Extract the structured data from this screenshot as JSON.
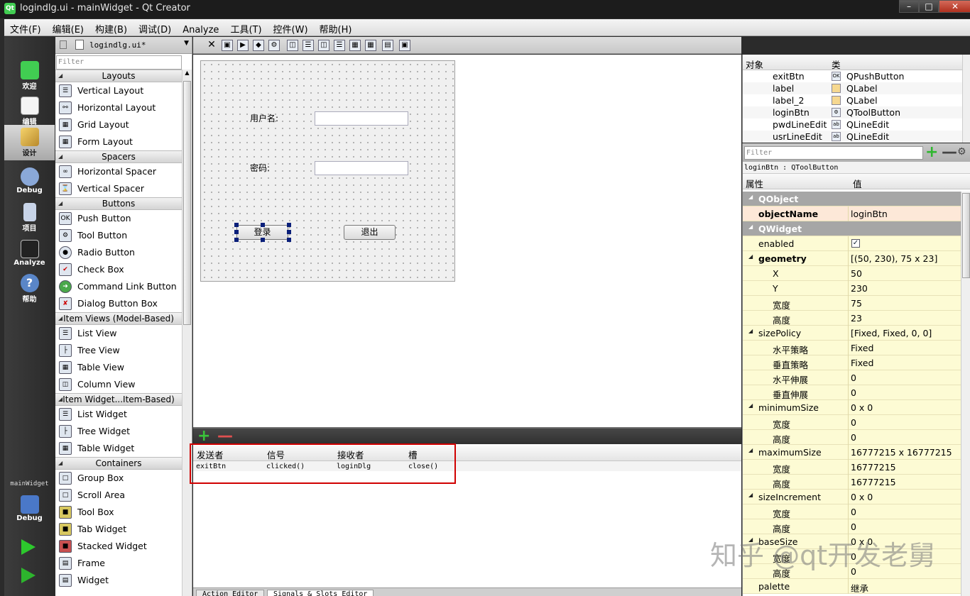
{
  "window": {
    "title": "logindlg.ui - mainWidget - Qt Creator",
    "icon_label": "Qt"
  },
  "menubar": [
    "文件(F)",
    "编辑(E)",
    "构建(B)",
    "调试(D)",
    "Analyze",
    "工具(T)",
    "控件(W)",
    "帮助(H)"
  ],
  "modes": [
    {
      "label": "欢迎",
      "icon": "qt-logo-icon"
    },
    {
      "label": "编辑",
      "icon": "edit-document-icon"
    },
    {
      "label": "设计",
      "icon": "design-pencil-icon"
    },
    {
      "label": "Debug",
      "icon": "debug-bug-icon"
    },
    {
      "label": "项目",
      "icon": "project-icon"
    },
    {
      "label": "Analyze",
      "icon": "analyze-scope-icon"
    },
    {
      "label": "帮助",
      "icon": "help-icon"
    }
  ],
  "kit": {
    "project": "mainWidget",
    "config": "Debug"
  },
  "editor_file": "logindlg.ui*",
  "widgetbox": {
    "filter_placeholder": "Filter",
    "categories": [
      {
        "name": "Layouts",
        "items": [
          "Vertical Layout",
          "Horizontal Layout",
          "Grid Layout",
          "Form Layout"
        ]
      },
      {
        "name": "Spacers",
        "items": [
          "Horizontal Spacer",
          "Vertical Spacer"
        ]
      },
      {
        "name": "Buttons",
        "items": [
          "Push Button",
          "Tool Button",
          "Radio Button",
          "Check Box",
          "Command Link Button",
          "Dialog Button Box"
        ]
      },
      {
        "name": "Item Views (Model-Based)",
        "items": [
          "List View",
          "Tree View",
          "Table View",
          "Column View"
        ]
      },
      {
        "name": "Item Widget...Item-Based)",
        "items": [
          "List Widget",
          "Tree Widget",
          "Table Widget"
        ]
      },
      {
        "name": "Containers",
        "items": [
          "Group Box",
          "Scroll Area",
          "Tool Box",
          "Tab Widget",
          "Stacked Widget",
          "Frame",
          "Widget"
        ]
      }
    ]
  },
  "form": {
    "username_label": "用户名:",
    "password_label": "密码:",
    "login_button": "登录",
    "exit_button": "退出"
  },
  "signals_slots": {
    "columns": [
      "发送者",
      "信号",
      "接收者",
      "槽"
    ],
    "rows": [
      {
        "sender": "exitBtn",
        "signal": "clicked()",
        "receiver": "loginDlg",
        "slot": "close()"
      }
    ],
    "tabs": [
      "Action Editor",
      "Signals & Slots Editor"
    ]
  },
  "object_inspector": {
    "columns": [
      "对象",
      "类"
    ],
    "rows": [
      {
        "object": "exitBtn",
        "class": "QPushButton"
      },
      {
        "object": "label",
        "class": "QLabel"
      },
      {
        "object": "label_2",
        "class": "QLabel"
      },
      {
        "object": "loginBtn",
        "class": "QToolButton"
      },
      {
        "object": "pwdLineEdit",
        "class": "QLineEdit"
      },
      {
        "object": "usrLineEdit",
        "class": "QLineEdit"
      }
    ]
  },
  "property_editor": {
    "filter_placeholder": "Filter",
    "current_object": "loginBtn : QToolButton",
    "columns": [
      "属性",
      "值"
    ],
    "rows": [
      {
        "key": "QObject",
        "value": "",
        "kind": "group"
      },
      {
        "key": "objectName",
        "value": "loginBtn",
        "kind": "bold-pink"
      },
      {
        "key": "QWidget",
        "value": "",
        "kind": "group"
      },
      {
        "key": "enabled",
        "value": "✓",
        "kind": "check"
      },
      {
        "key": "geometry",
        "value": "[(50, 230), 75 x 23]",
        "kind": "bold-expand"
      },
      {
        "key": "X",
        "value": "50",
        "kind": "child"
      },
      {
        "key": "Y",
        "value": "230",
        "kind": "child"
      },
      {
        "key": "宽度",
        "value": "75",
        "kind": "child"
      },
      {
        "key": "高度",
        "value": "23",
        "kind": "child"
      },
      {
        "key": "sizePolicy",
        "value": "[Fixed, Fixed, 0, 0]",
        "kind": "expand"
      },
      {
        "key": "水平策略",
        "value": "Fixed",
        "kind": "child"
      },
      {
        "key": "垂直策略",
        "value": "Fixed",
        "kind": "child"
      },
      {
        "key": "水平伸展",
        "value": "0",
        "kind": "child"
      },
      {
        "key": "垂直伸展",
        "value": "0",
        "kind": "child"
      },
      {
        "key": "minimumSize",
        "value": "0 x 0",
        "kind": "expand"
      },
      {
        "key": "宽度",
        "value": "0",
        "kind": "child"
      },
      {
        "key": "高度",
        "value": "0",
        "kind": "child"
      },
      {
        "key": "maximumSize",
        "value": "16777215 x 16777215",
        "kind": "expand"
      },
      {
        "key": "宽度",
        "value": "16777215",
        "kind": "child"
      },
      {
        "key": "高度",
        "value": "16777215",
        "kind": "child"
      },
      {
        "key": "sizeIncrement",
        "value": "0 x 0",
        "kind": "expand"
      },
      {
        "key": "宽度",
        "value": "0",
        "kind": "child"
      },
      {
        "key": "高度",
        "value": "0",
        "kind": "child"
      },
      {
        "key": "baseSize",
        "value": "0 x 0",
        "kind": "expand"
      },
      {
        "key": "宽度",
        "value": "0",
        "kind": "child"
      },
      {
        "key": "高度",
        "value": "0",
        "kind": "child"
      },
      {
        "key": "palette",
        "value": "继承",
        "kind": "plain"
      }
    ]
  },
  "watermark": "知乎 @qt开发老舅"
}
